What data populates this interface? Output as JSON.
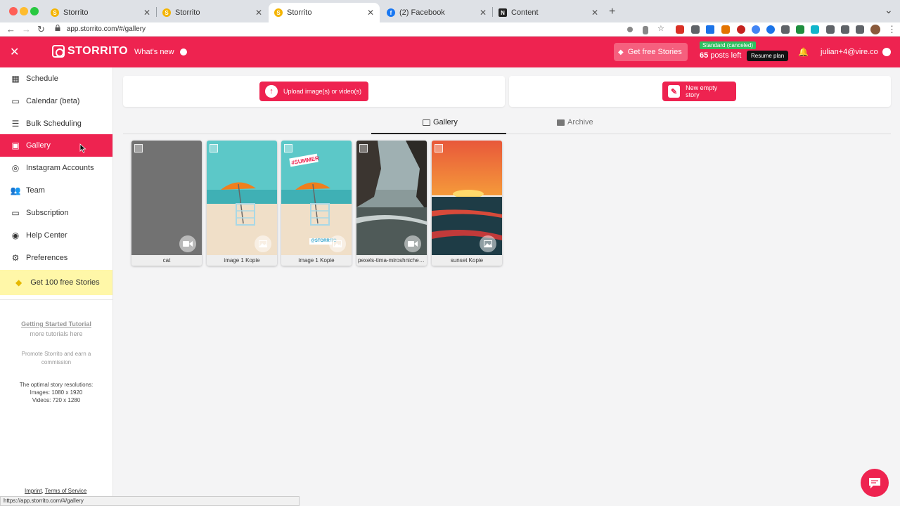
{
  "browser": {
    "tabs": [
      {
        "label": "Storrito"
      },
      {
        "label": "Storrito"
      },
      {
        "label": "Storrito"
      },
      {
        "label": "(2) Facebook"
      },
      {
        "label": "Content"
      }
    ],
    "url": "app.storrito.com/#/gallery",
    "status_url": "https://app.storrito.com/#/gallery"
  },
  "header": {
    "logo_text": "STORRITO",
    "whats_new": "What's new",
    "get_free_stories": "Get free Stories",
    "plan_badge": "Standard (canceled)",
    "posts_count": "65",
    "posts_left_label": "posts left",
    "resume_plan": "Resume plan",
    "user_email": "julian+4@vire.co",
    "brand_color": "#ee2350"
  },
  "sidebar": {
    "items": [
      {
        "label": "Schedule",
        "icon": "calendar-grid-icon"
      },
      {
        "label": "Calendar (beta)",
        "icon": "calendar-icon"
      },
      {
        "label": "Bulk Scheduling",
        "icon": "list-icon"
      },
      {
        "label": "Gallery",
        "icon": "images-icon",
        "active": true
      },
      {
        "label": "Instagram Accounts",
        "icon": "instagram-icon"
      },
      {
        "label": "Team",
        "icon": "team-icon"
      },
      {
        "label": "Subscription",
        "icon": "credit-card-icon"
      },
      {
        "label": "Help Center",
        "icon": "help-icon"
      },
      {
        "label": "Preferences",
        "icon": "gear-icon"
      }
    ],
    "promo": "Get 100 free Stories",
    "tutorial_link": "Getting Started Tutorial",
    "more_tutorials": "more tutorials here",
    "promote": "Promote Storrito and earn a commission",
    "resolutions_title": "The optimal story resolutions:",
    "resolutions_images": "Images: 1080 x 1920",
    "resolutions_videos": "Videos: 720 x 1280",
    "imprint": "Imprint",
    "terms": "Terms of Service"
  },
  "main": {
    "upload_button": "Upload image(s) or video(s)",
    "new_story_button": "New empty story",
    "tabs": [
      {
        "label": "Gallery",
        "active": true
      },
      {
        "label": "Archive",
        "active": false
      }
    ],
    "media": [
      {
        "caption": "cat",
        "type": "video"
      },
      {
        "caption": "image 1 Kopie",
        "type": "image"
      },
      {
        "caption": "image 1 Kopie",
        "type": "image",
        "sticker": "#SUMMER",
        "watermark": "@STORRITO"
      },
      {
        "caption": "pexels-tima-miroshnichenko",
        "type": "video"
      },
      {
        "caption": "sunset Kopie",
        "type": "image"
      }
    ]
  }
}
